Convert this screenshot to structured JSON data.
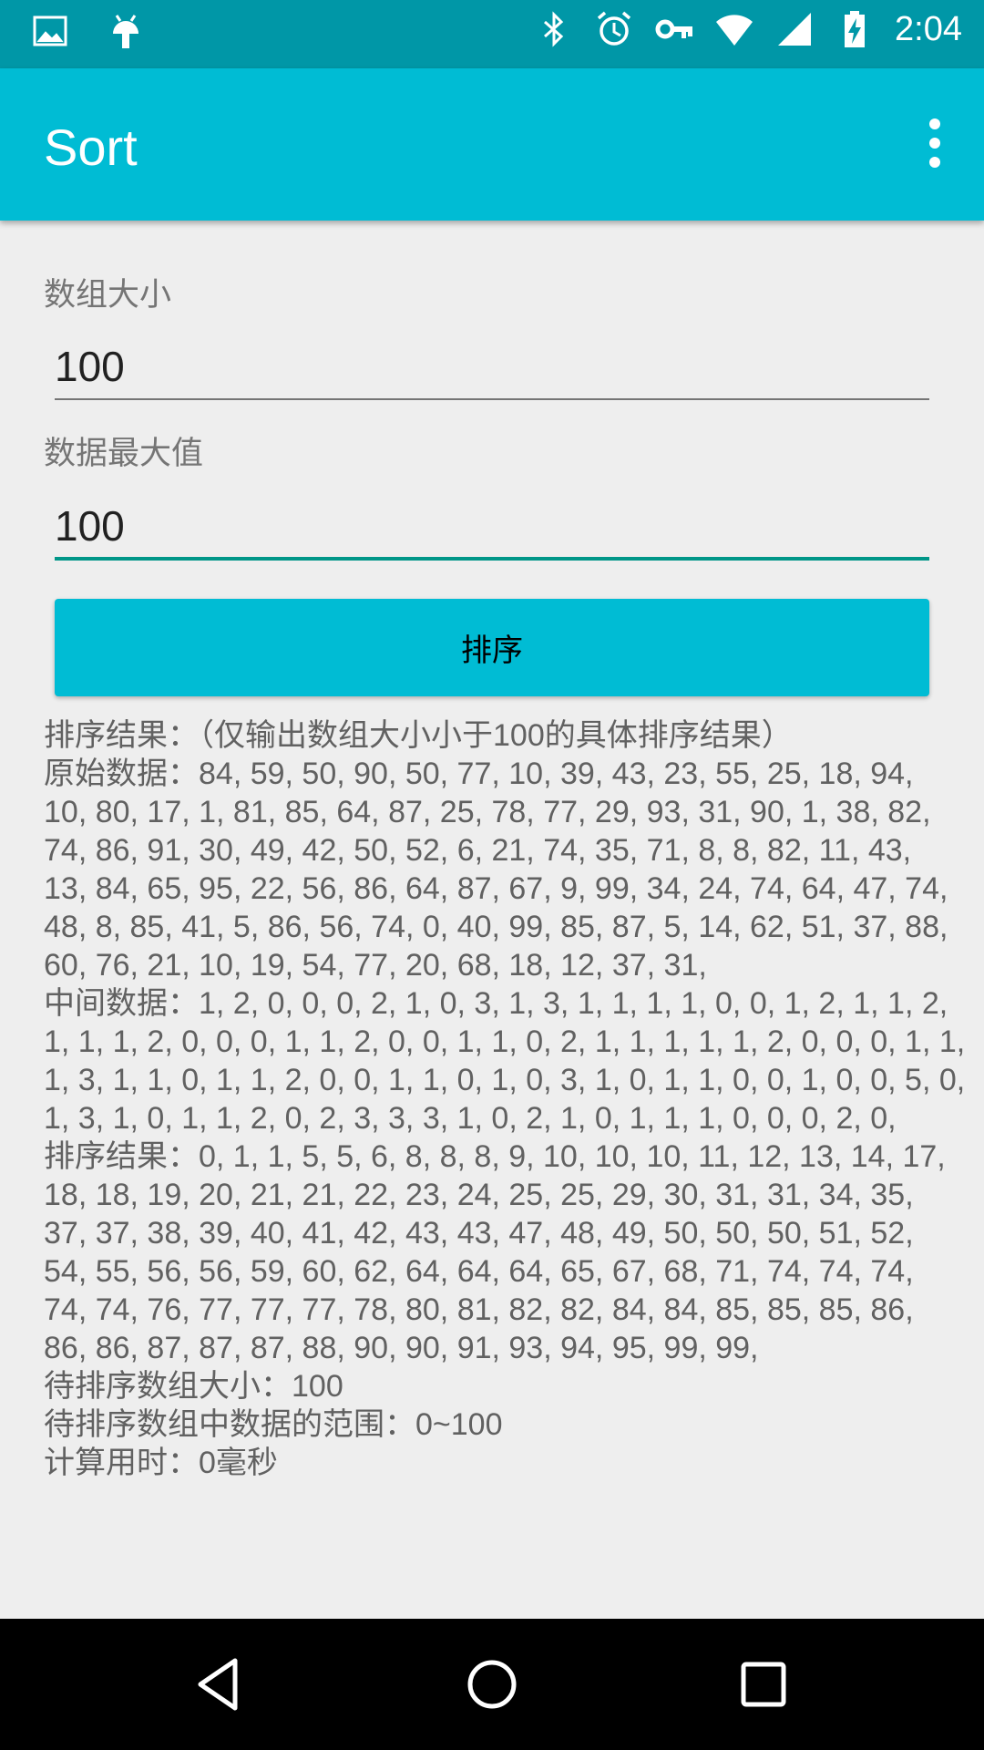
{
  "status_bar": {
    "time": "2:04",
    "left_icons": [
      "image-notification-icon",
      "android-debug-icon"
    ],
    "right_icons": [
      "bluetooth-icon",
      "alarm-icon",
      "vpn-key-icon",
      "wifi-icon",
      "cell-signal-icon",
      "battery-charging-icon"
    ]
  },
  "app_bar": {
    "title": "Sort",
    "overflow_icon": "more-vert-icon"
  },
  "form": {
    "array_size_label": "数组大小",
    "array_size_value": "100",
    "max_value_label": "数据最大值",
    "max_value_value": "100",
    "sort_button_label": "排序"
  },
  "result": {
    "lines": [
      "排序结果：（仅输出数组大小小于100的具体排序结果）",
      "原始数据：84, 59, 50, 90, 50, 77, 10, 39, 43, 23, 55, 25, 18, 94,",
      "10, 80, 17, 1, 81, 85, 64, 87, 25, 78, 77, 29, 93, 31, 90, 1, 38, 82,",
      "74, 86, 91, 30, 49, 42, 50, 52, 6, 21, 74, 35, 71, 8, 8, 82, 11, 43,",
      "13, 84, 65, 95, 22, 56, 86, 64, 87, 67, 9, 99, 34, 24, 74, 64, 47, 74,",
      "48, 8, 85, 41, 5, 86, 56, 74, 0, 40, 99, 85, 87, 5, 14, 62, 51, 37, 88,",
      "60, 76, 21, 10, 19, 54, 77, 20, 68, 18, 12, 37, 31,",
      "中间数据：1, 2, 0, 0, 0, 2, 1, 0, 3, 1, 3, 1, 1, 1, 1, 0, 0, 1, 2, 1, 1, 2,",
      "1, 1, 1, 2, 0, 0, 0, 1, 1, 2, 0, 0, 1, 1, 0, 2, 1, 1, 1, 1, 1, 2, 0, 0, 0, 1, 1,",
      "1, 3, 1, 1, 0, 1, 1, 2, 0, 0, 1, 1, 0, 1, 0, 3, 1, 0, 1, 1, 0, 0, 1, 0, 0, 5, 0,",
      "1, 3, 1, 0, 1, 1, 2, 0, 2, 3, 3, 3, 1, 0, 2, 1, 0, 1, 1, 1, 0, 0, 0, 2, 0,",
      "排序结果：0, 1, 1, 5, 5, 6, 8, 8, 8, 9, 10, 10, 10, 11, 12, 13, 14, 17,",
      "18, 18, 19, 20, 21, 21, 22, 23, 24, 25, 25, 29, 30, 31, 31, 34, 35,",
      "37, 37, 38, 39, 40, 41, 42, 43, 43, 47, 48, 49, 50, 50, 50, 51, 52,",
      "54, 55, 56, 56, 59, 60, 62, 64, 64, 64, 65, 67, 68, 71, 74, 74, 74,",
      "74, 74, 76, 77, 77, 77, 78, 80, 81, 82, 82, 84, 84, 85, 85, 85, 86,",
      "86, 86, 87, 87, 87, 88, 90, 90, 91, 93, 94, 95, 99, 99,",
      "待排序数组大小：100",
      "待排序数组中数据的范围：0~100",
      "计算用时：0毫秒"
    ]
  },
  "nav_bar": {
    "icons": [
      "back-icon",
      "home-icon",
      "recents-icon"
    ]
  }
}
